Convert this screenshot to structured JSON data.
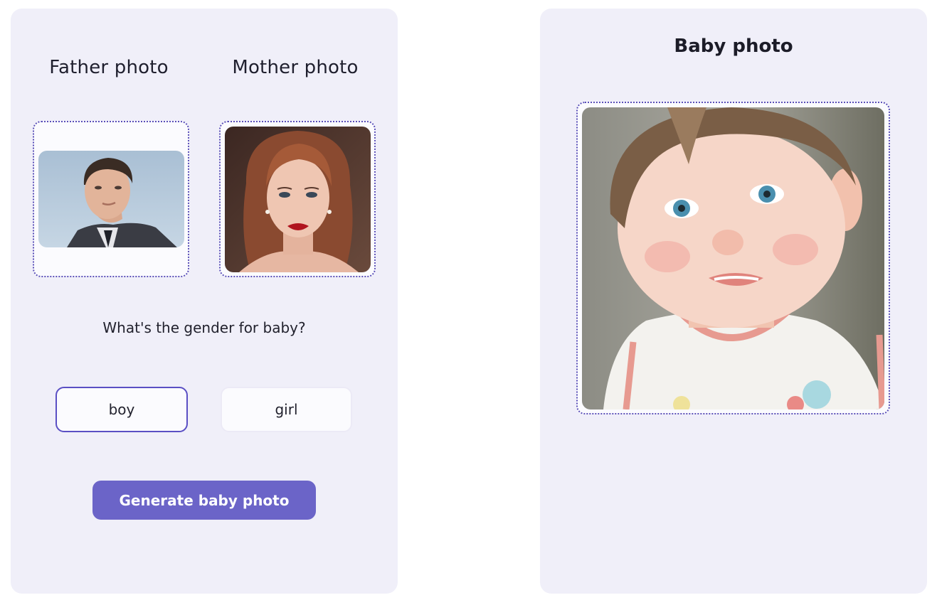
{
  "left_panel": {
    "father_title": "Father photo",
    "mother_title": "Mother photo",
    "gender_question": "What's the gender for baby?",
    "gender_options": [
      "boy",
      "girl"
    ],
    "selected_gender": "boy",
    "generate_label": "Generate baby photo"
  },
  "right_panel": {
    "title": "Baby photo"
  },
  "colors": {
    "panel_bg": "#f0eff9",
    "accent": "#6b64c8",
    "selected_border": "#5a4fc4",
    "dotted_border": "#5a4fb8"
  }
}
